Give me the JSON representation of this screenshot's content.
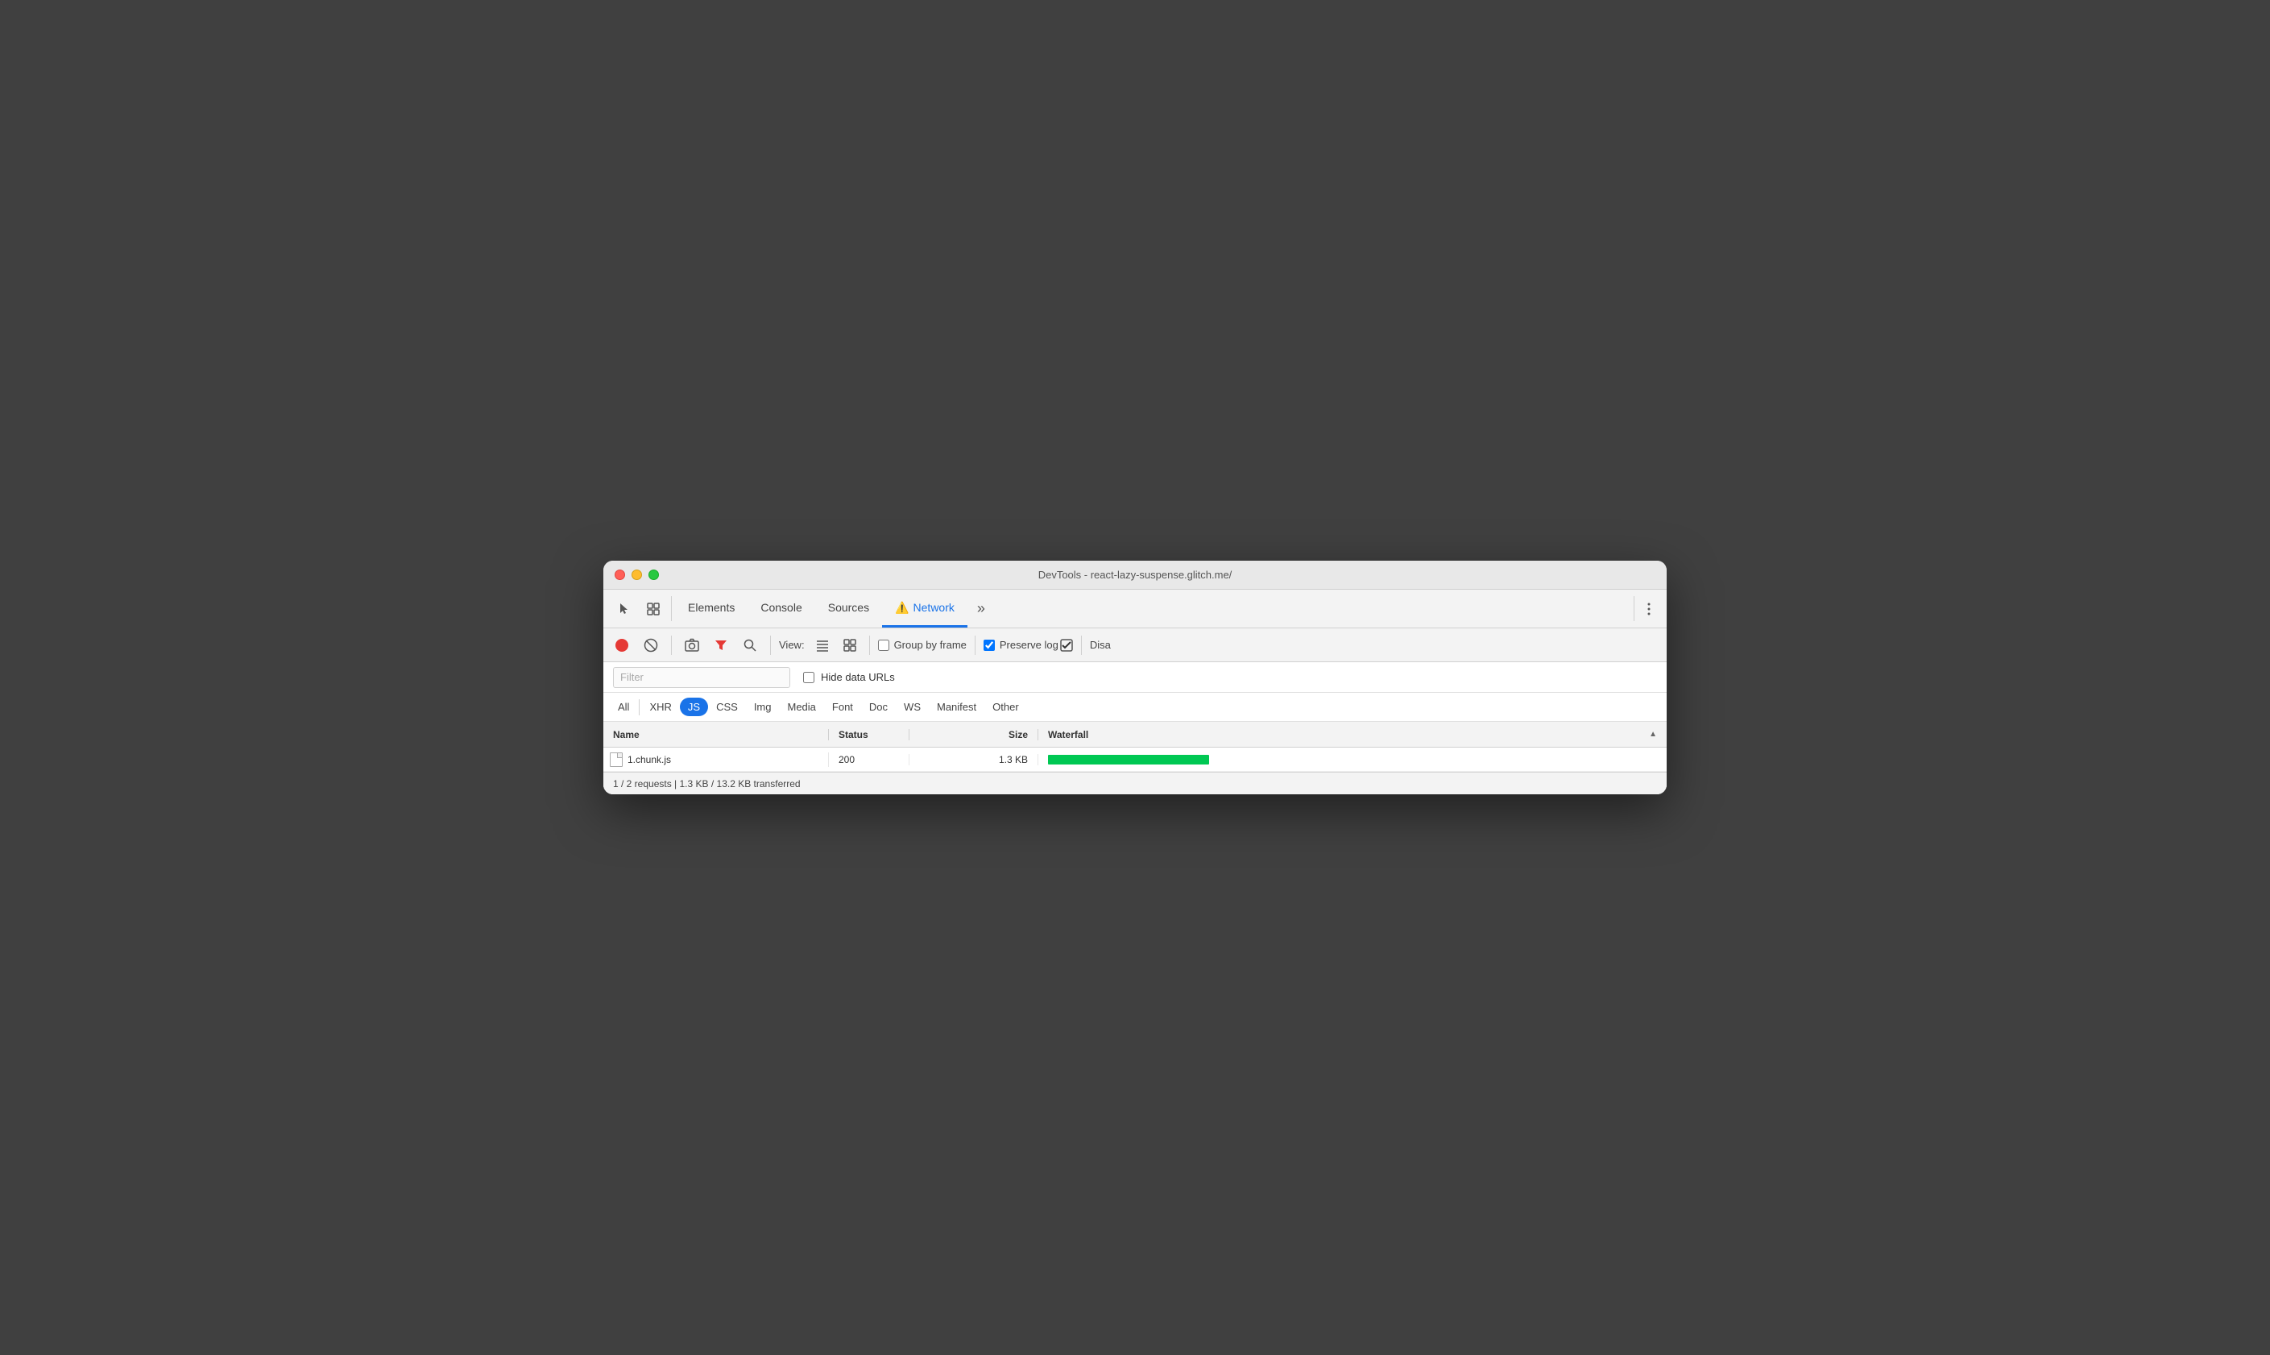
{
  "window": {
    "title": "DevTools - react-lazy-suspense.glitch.me/"
  },
  "tabs": {
    "items": [
      {
        "id": "elements",
        "label": "Elements",
        "active": false
      },
      {
        "id": "console",
        "label": "Console",
        "active": false
      },
      {
        "id": "sources",
        "label": "Sources",
        "active": false
      },
      {
        "id": "network",
        "label": "Network",
        "active": true,
        "hasWarning": true
      },
      {
        "id": "more",
        "label": "»",
        "active": false
      }
    ]
  },
  "toolbar": {
    "record_label": "●",
    "clear_label": "🚫",
    "camera_label": "📷",
    "filter_label": "▼",
    "search_label": "🔍",
    "view_label": "View:",
    "view_list_label": "≡",
    "view_group_label": "⊞",
    "group_by_frame_label": "Group by frame",
    "preserve_log_label": "Preserve log",
    "disable_cache_label": "Disa",
    "group_by_frame_checked": false,
    "preserve_log_checked": true
  },
  "filter_bar": {
    "filter_placeholder": "Filter",
    "filter_value": "",
    "hide_data_urls_label": "Hide data URLs",
    "hide_data_urls_checked": false
  },
  "type_filters": {
    "items": [
      {
        "id": "all",
        "label": "All",
        "active": false
      },
      {
        "id": "xhr",
        "label": "XHR",
        "active": false
      },
      {
        "id": "js",
        "label": "JS",
        "active": true
      },
      {
        "id": "css",
        "label": "CSS",
        "active": false
      },
      {
        "id": "img",
        "label": "Img",
        "active": false
      },
      {
        "id": "media",
        "label": "Media",
        "active": false
      },
      {
        "id": "font",
        "label": "Font",
        "active": false
      },
      {
        "id": "doc",
        "label": "Doc",
        "active": false
      },
      {
        "id": "ws",
        "label": "WS",
        "active": false
      },
      {
        "id": "manifest",
        "label": "Manifest",
        "active": false
      },
      {
        "id": "other",
        "label": "Other",
        "active": false
      }
    ]
  },
  "table": {
    "headers": {
      "name": "Name",
      "status": "Status",
      "size": "Size",
      "waterfall": "Waterfall"
    },
    "rows": [
      {
        "name": "1.chunk.js",
        "status": "200",
        "size": "1.3 KB",
        "waterfall_width": 200,
        "waterfall_offset": 0,
        "waterfall_color": "#00c853"
      }
    ]
  },
  "status_bar": {
    "text": "1 / 2 requests | 1.3 KB / 13.2 KB transferred"
  },
  "colors": {
    "accent": "#1a73e8",
    "record_red": "#e53935",
    "filter_red": "#e53935",
    "active_tab_blue": "#1a73e8",
    "waterfall_green": "#00c853"
  }
}
